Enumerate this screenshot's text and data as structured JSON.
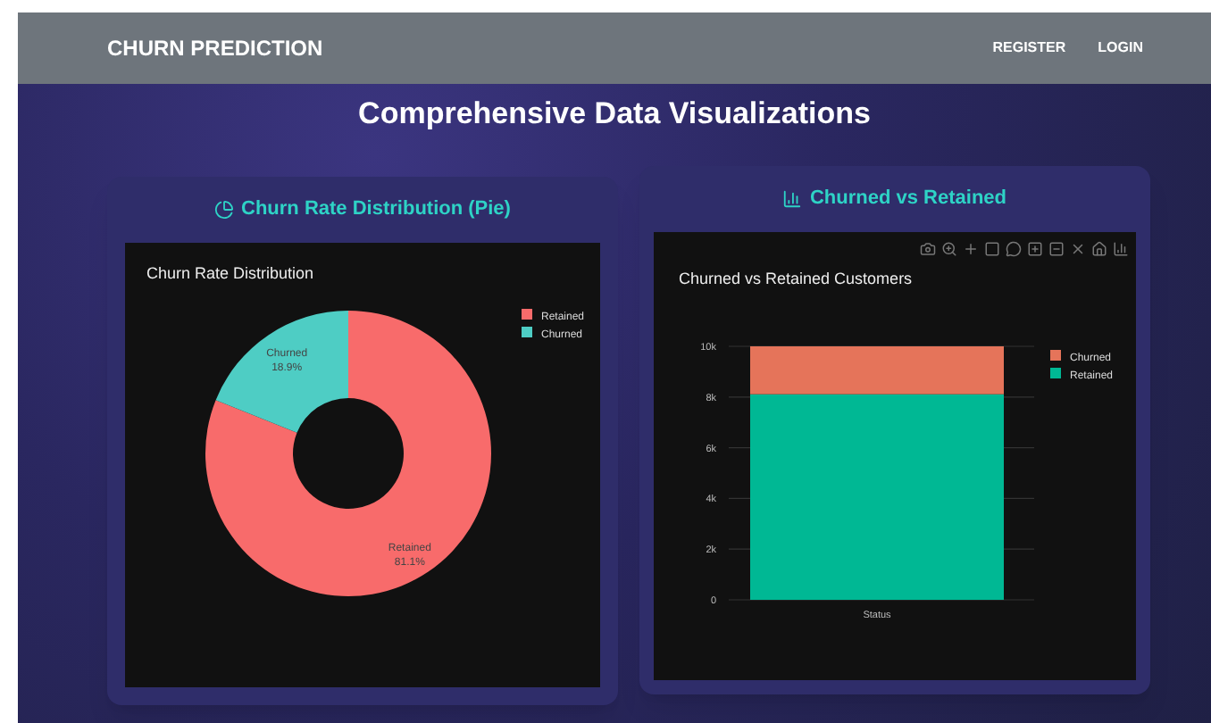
{
  "navbar": {
    "brand": "CHURN PREDICTION",
    "links": [
      "REGISTER",
      "LOGIN"
    ]
  },
  "page_title": "Comprehensive Data Visualizations",
  "cards": [
    {
      "kind": "pie",
      "heading": "Churn Rate Distribution (Pie)",
      "chart_data": {
        "type": "donut",
        "title": "Churn Rate Distribution",
        "categories": [
          "Retained",
          "Churned"
        ],
        "values": [
          81.1,
          18.9
        ],
        "colors": [
          "#f86b6b",
          "#4ecdc4"
        ],
        "value_labels": [
          "81.1%",
          "18.9%"
        ],
        "legend": true
      }
    },
    {
      "kind": "bar",
      "heading": "Churned vs Retained",
      "chart_data": {
        "type": "bar",
        "title": "Churned vs Retained Customers",
        "categories": [
          "Status"
        ],
        "stacked": true,
        "grid": true,
        "legend": true,
        "series": [
          {
            "name": "Churned",
            "color": "#e5745a",
            "values": [
              1890
            ]
          },
          {
            "name": "Retained",
            "color": "#00b894",
            "values": [
              8110
            ]
          }
        ],
        "ylim": [
          0,
          10000
        ],
        "yticks": [
          {
            "value": 0,
            "label": "0"
          },
          {
            "value": 2000,
            "label": "2k"
          },
          {
            "value": 4000,
            "label": "4k"
          },
          {
            "value": 6000,
            "label": "6k"
          },
          {
            "value": 8000,
            "label": "8k"
          },
          {
            "value": 10000,
            "label": "10k"
          }
        ]
      }
    }
  ]
}
